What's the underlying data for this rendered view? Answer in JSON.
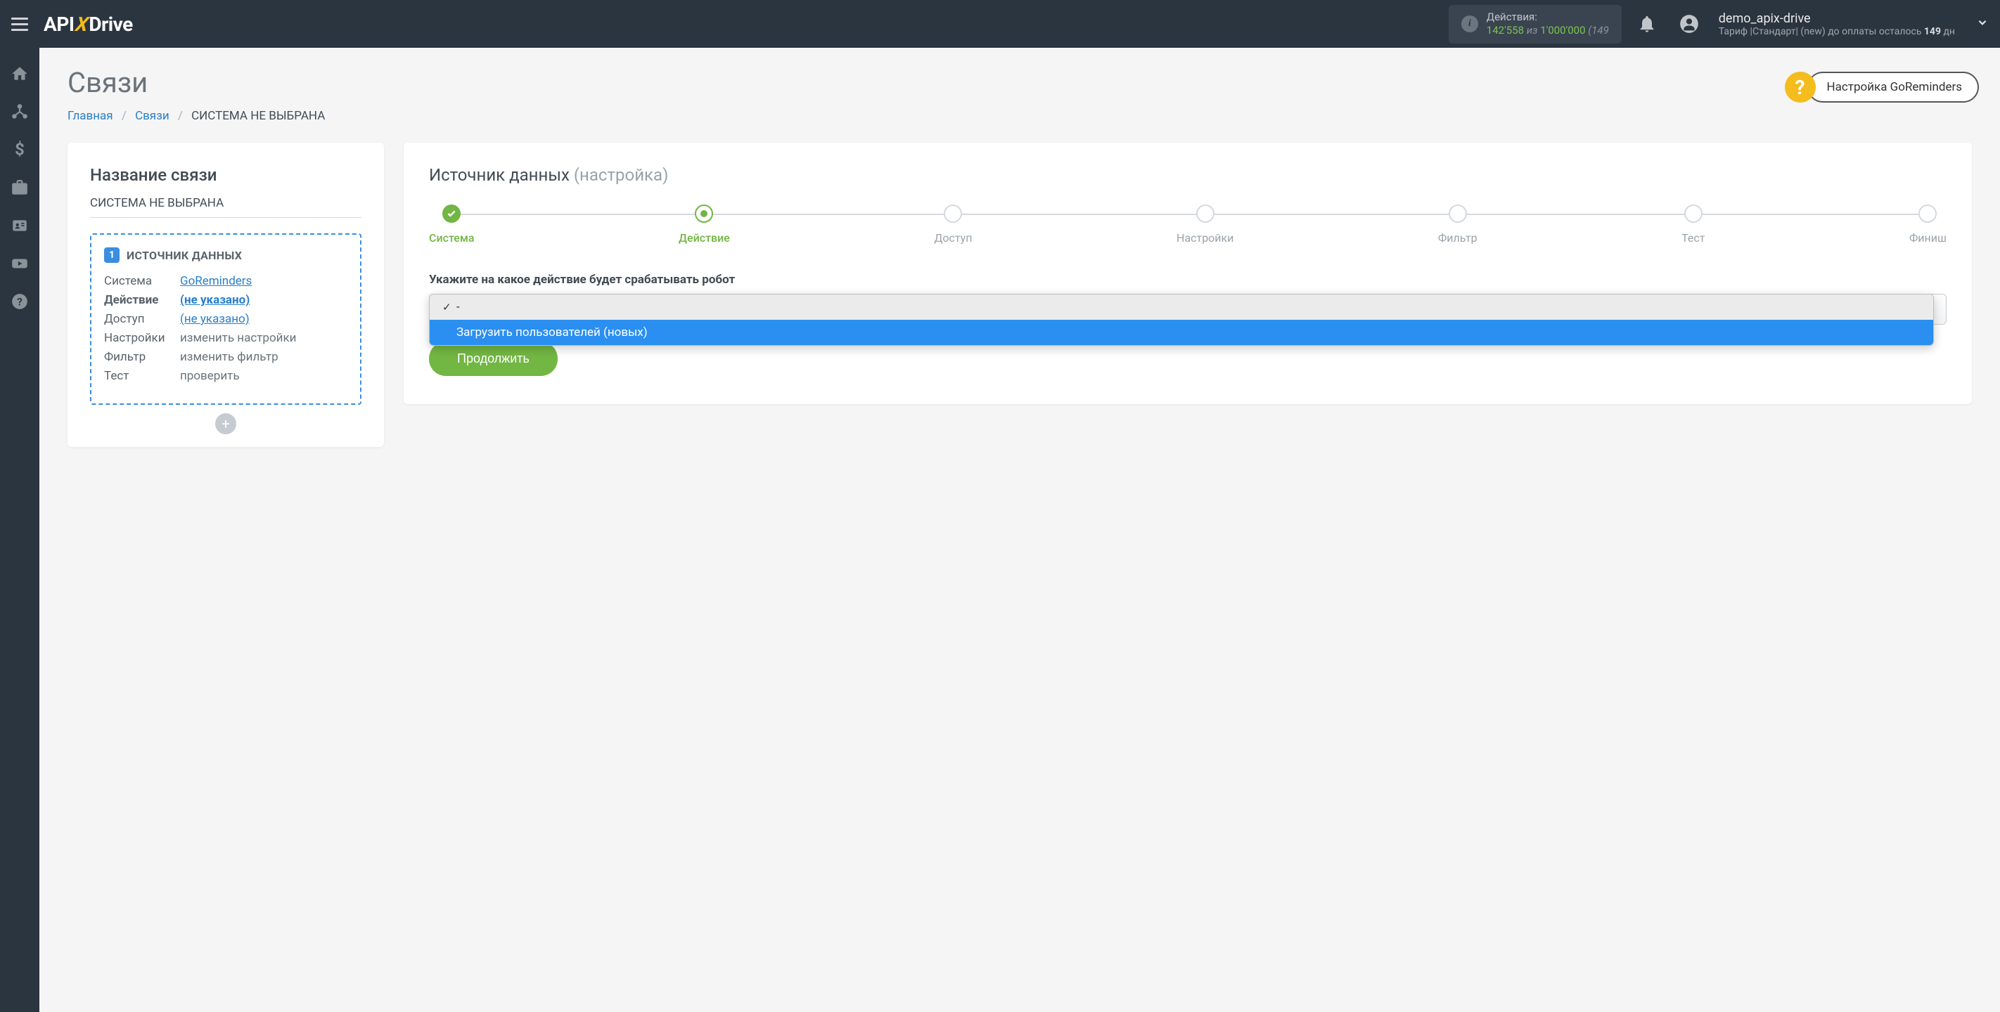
{
  "header": {
    "logo": {
      "api": "API",
      "x": "X",
      "drive": "Drive"
    },
    "actions": {
      "label": "Действия:",
      "count": "142'558",
      "of_word": "из",
      "total": "1'000'000",
      "extra": "(149"
    },
    "user": {
      "name": "demo_apix-drive",
      "tariff_prefix": "Тариф |Стандарт| (new) до оплаты осталось ",
      "days": "149",
      "days_suffix": " дн"
    }
  },
  "page": {
    "title": "Связи",
    "breadcrumb": {
      "home": "Главная",
      "links": "Связи",
      "current": "СИСТЕМА НЕ ВЫБРАНА"
    },
    "help_badge": "Настройка GoReminders"
  },
  "left_card": {
    "title": "Название связи",
    "subtitle": "СИСТЕМА НЕ ВЫБРАНА",
    "box": {
      "num": "1",
      "title": "ИСТОЧНИК ДАННЫХ",
      "rows": {
        "system": {
          "key": "Система",
          "val": "GoReminders"
        },
        "action": {
          "key": "Действие",
          "val": "(не указано)"
        },
        "access": {
          "key": "Доступ",
          "val": "(не указано)"
        },
        "settings": {
          "key": "Настройки",
          "val": "изменить настройки"
        },
        "filter": {
          "key": "Фильтр",
          "val": "изменить фильтр"
        },
        "test": {
          "key": "Тест",
          "val": "проверить"
        }
      }
    }
  },
  "right_card": {
    "title_main": "Источник данных ",
    "title_muted": "(настройка)",
    "steps": {
      "system": "Система",
      "action": "Действие",
      "access": "Доступ",
      "settings": "Настройки",
      "filter": "Фильтр",
      "test": "Тест",
      "finish": "Финиш"
    },
    "field_label": "Укажите на какое действие будет срабатывать робот",
    "dropdown": {
      "empty": "-",
      "option1": "Загрузить пользователей (новых)"
    },
    "continue": "Продолжить"
  }
}
